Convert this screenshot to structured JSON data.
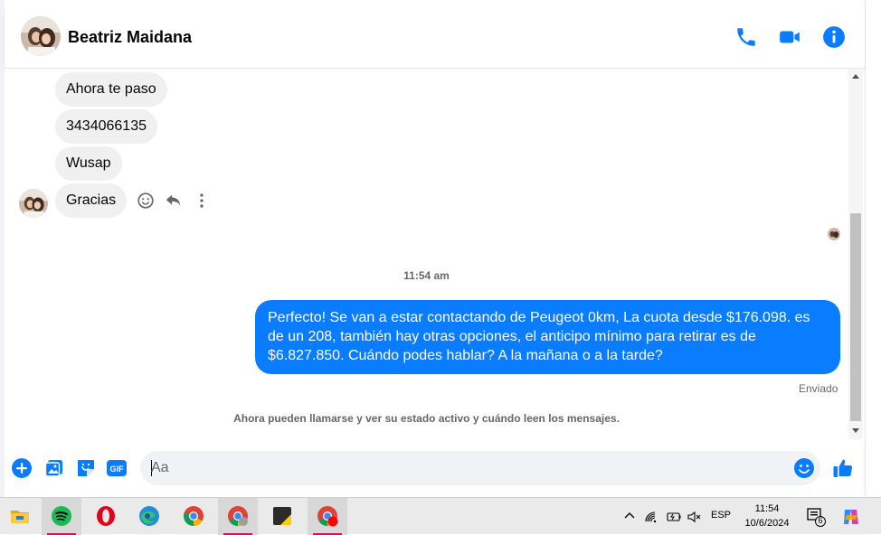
{
  "colors": {
    "accent": "#0a7cff",
    "incoming_bubble": "#f0f0f0",
    "taskbar_active_underline": "#c2185b"
  },
  "header": {
    "contact_name": "Beatriz Maidana",
    "icons": [
      "phone-icon",
      "video-call-icon",
      "info-icon"
    ]
  },
  "messages": {
    "incoming": [
      "Ahora te paso",
      "3434066135",
      "Wusap",
      "Gracias"
    ],
    "message_actions": [
      "react-icon",
      "reply-icon",
      "more-options-icon"
    ],
    "timestamp": "11:54 am",
    "outgoing": "Perfecto!  Se van a estar contactando de Peugeot 0km, La cuota desde $176.098. es de un 208, también hay otras opciones, el anticipo mínimo para retirar es de $6.827.850. Cuándo podes hablar? A la mañana o a la tarde?",
    "status": "Enviado",
    "info_note": "Ahora pueden llamarse y ver su estado activo y cuándo leen los mensajes."
  },
  "composer": {
    "placeholder": "Aa",
    "value": "",
    "icons": [
      "plus-icon",
      "image-icon",
      "sticker-icon",
      "gif-icon",
      "emoji-icon",
      "like-icon"
    ],
    "gif_label": "GIF"
  },
  "taskbar": {
    "apps": [
      "file-explorer-icon",
      "spotify-icon",
      "opera-icon",
      "edge-icon",
      "chrome-icon",
      "chrome-profile-icon",
      "sticky-notes-icon",
      "chrome-recording-icon"
    ],
    "language": "ESP",
    "time": "11:54",
    "date": "10/6/2024",
    "notification_count": "6"
  }
}
